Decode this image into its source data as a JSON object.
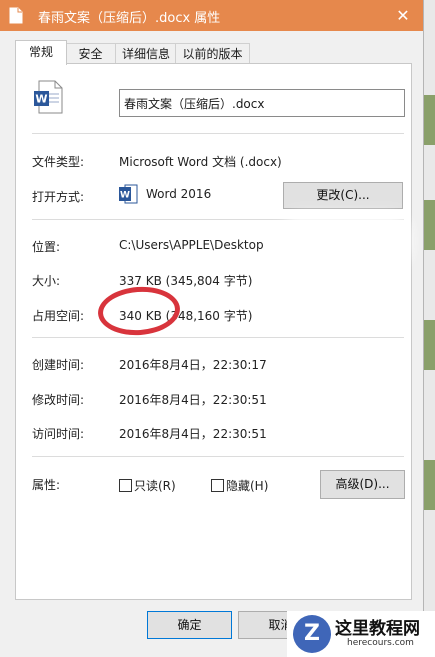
{
  "window": {
    "title": "春雨文案（压缩后）.docx 属性",
    "close_glyph": "✕",
    "titlebar_color": "#e6884c"
  },
  "tabs": [
    {
      "label": "常规",
      "active": true
    },
    {
      "label": "安全",
      "active": false
    },
    {
      "label": "详细信息",
      "active": false
    },
    {
      "label": "以前的版本",
      "active": false
    }
  ],
  "general": {
    "file_icon": "word-document-icon",
    "file_name": "春雨文案（压缩后）.docx",
    "file_type_label": "文件类型:",
    "file_type_value": "Microsoft Word 文档 (.docx)",
    "opens_with_label": "打开方式:",
    "opens_with_value": "Word 2016",
    "change_button": "更改(C)...",
    "location_label": "位置:",
    "location_value": "C:\\Users\\APPLE\\Desktop",
    "size_label": "大小:",
    "size_value": "337 KB (345,804 字节)",
    "size_on_disk_label": "占用空间:",
    "size_on_disk_value": "340 KB (348,160 字节)",
    "created_label": "创建时间:",
    "created_value": "2016年8月4日，22:30:17",
    "modified_label": "修改时间:",
    "modified_value": "2016年8月4日，22:30:51",
    "accessed_label": "访问时间:",
    "accessed_value": "2016年8月4日，22:30:51",
    "attributes_label": "属性:",
    "readonly_label": "只读(R)",
    "hidden_label": "隐藏(H)",
    "advanced_button": "高级(D)..."
  },
  "footer": {
    "ok_button": "确定",
    "cancel_button": "取消"
  },
  "watermark": {
    "logo_letter": "Z",
    "title": "这里教程网",
    "url": "herecours.com"
  }
}
